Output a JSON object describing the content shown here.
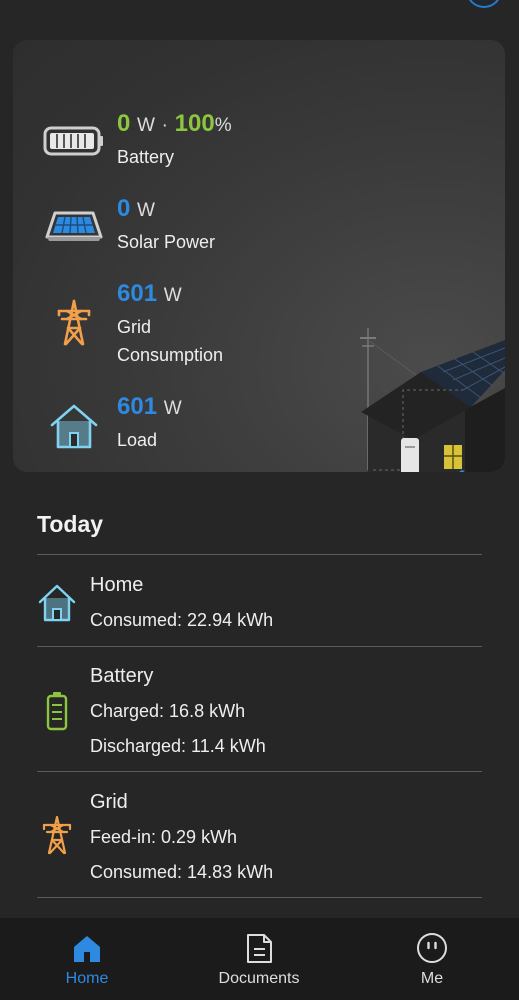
{
  "status": {
    "battery": {
      "power": "0",
      "unit": "W",
      "separator": "·",
      "soc": "100",
      "soc_unit": "%",
      "label": "Battery"
    },
    "solar": {
      "power": "0",
      "unit": "W",
      "label": "Solar Power"
    },
    "grid": {
      "power": "601",
      "unit": "W",
      "label_line1": "Grid",
      "label_line2": "Consumption"
    },
    "load": {
      "power": "601",
      "unit": "W",
      "label": "Load"
    }
  },
  "today": {
    "title": "Today",
    "home": {
      "name": "Home",
      "consumed": "Consumed: 22.94 kWh"
    },
    "battery": {
      "name": "Battery",
      "charged": "Charged: 16.8 kWh",
      "discharged": "Discharged: 11.4 kWh"
    },
    "grid": {
      "name": "Grid",
      "feed_in": "Feed-in: 0.29 kWh",
      "consumed": "Consumed: 14.83 kWh"
    }
  },
  "nav": {
    "items": [
      {
        "label": "Home",
        "icon": "home-icon",
        "active": true
      },
      {
        "label": "Documents",
        "icon": "document-icon",
        "active": false
      },
      {
        "label": "Me",
        "icon": "face-icon",
        "active": false
      }
    ]
  },
  "colors": {
    "accent": "#2d8ae0",
    "battery_green": "#8cc63f",
    "grid_orange": "#f0a04b",
    "home_cyan": "#7fd3f0",
    "background": "#262626",
    "card": "#363636"
  }
}
